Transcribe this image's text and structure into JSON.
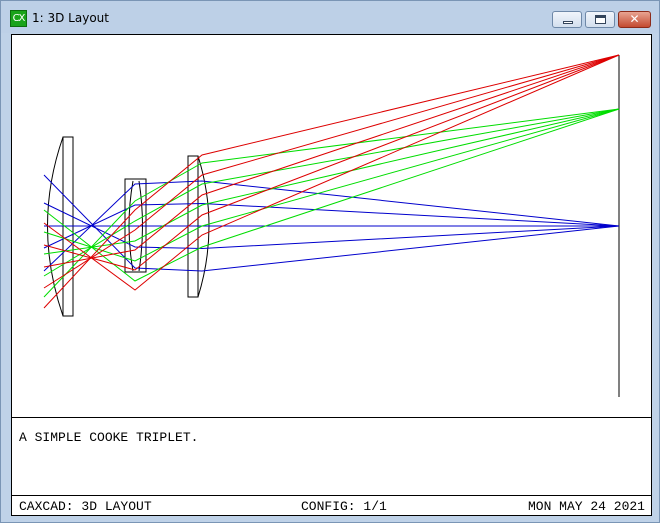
{
  "window": {
    "icon_label": "CX",
    "title": "1: 3D Layout",
    "close_glyph": "✕"
  },
  "layout_view": {
    "colors": {
      "field_1": "#0000cc",
      "field_2": "#00dd00",
      "field_3": "#dd0000",
      "lens": "#000000",
      "image_plane": "#000000"
    },
    "lens_count": 3,
    "fields": [
      "field_1",
      "field_2",
      "field_3"
    ]
  },
  "description": "A SIMPLE COOKE TRIPLET.",
  "status": {
    "program": "CAXCAD: 3D LAYOUT",
    "config": "CONFIG: 1/1",
    "date": "MON MAY 24 2021"
  }
}
